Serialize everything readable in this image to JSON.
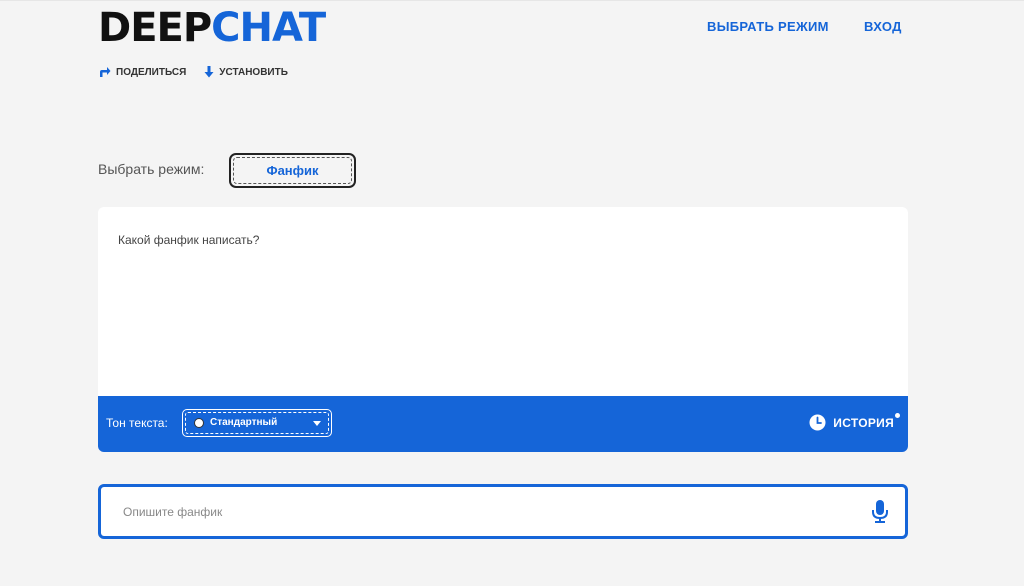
{
  "header": {
    "logo_part1": "DEEP",
    "logo_part2": "CHAT",
    "nav_mode": "ВЫБРАТЬ РЕЖИМ",
    "nav_login": "ВХОД"
  },
  "actions": {
    "share_label": "ПОДЕЛИТЬСЯ",
    "share_icon": "share-arrow-icon",
    "install_label": "УСТАНОВИТЬ",
    "install_icon": "download-arrow-icon"
  },
  "mode": {
    "label": "Выбрать режим:",
    "selected": "Фанфик"
  },
  "chat": {
    "question": "Какой фанфик написать?"
  },
  "toolbar": {
    "tone_label": "Тон текста:",
    "tone_value": "Стандартный",
    "history_label": "ИСТОРИЯ",
    "history_icon": "clock-icon"
  },
  "prompt": {
    "placeholder": "Опишите фанфик",
    "value": "",
    "mic_icon": "microphone-icon"
  },
  "colors": {
    "accent": "#1565d8",
    "background": "#f4f4f4",
    "logo_dark": "#111111"
  }
}
